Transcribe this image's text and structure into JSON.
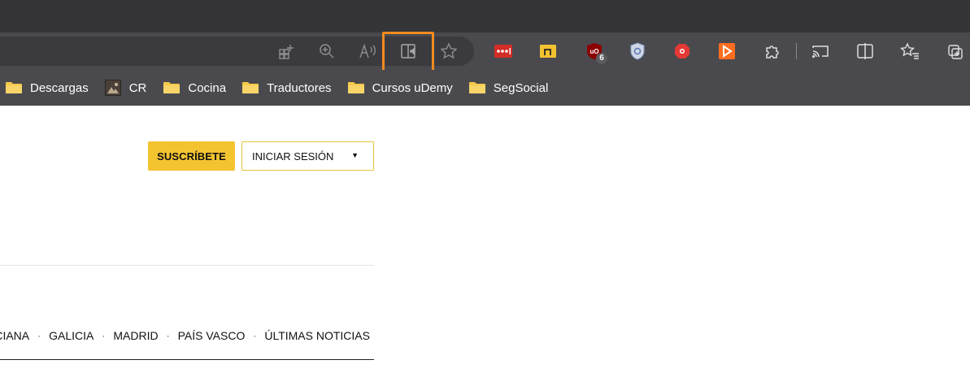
{
  "favorites": [
    {
      "label": "Descargas",
      "icon": "folder-icon"
    },
    {
      "label": "CR",
      "icon": "site-thumbnail-icon"
    },
    {
      "label": "Cocina",
      "icon": "folder-icon"
    },
    {
      "label": "Traductores",
      "icon": "folder-icon"
    },
    {
      "label": "Cursos uDemy",
      "icon": "folder-icon"
    },
    {
      "label": "SegSocial",
      "icon": "folder-icon"
    }
  ],
  "extensions": {
    "ublock_badge": "6"
  },
  "header": {
    "subscribe_label": "SUSCRÍBETE",
    "login_label": "INICIAR SESIÓN"
  },
  "nav": {
    "items": [
      "NCIANA",
      "GALICIA",
      "MADRID",
      "PAÍS VASCO",
      "ÚLTIMAS NOTICIAS"
    ],
    "separator": "·"
  },
  "colors": {
    "highlight": "#f58a1f",
    "subscribe_bg": "#f4c430",
    "toolbar_bg": "#4a4a4e",
    "titlebar_bg": "#353538"
  }
}
